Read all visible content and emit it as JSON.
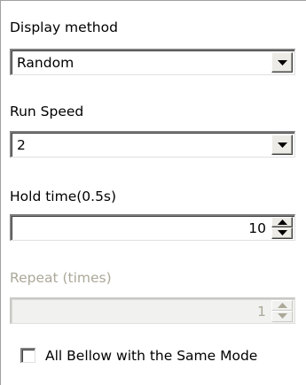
{
  "display_method": {
    "label": "Display method",
    "value": "Random"
  },
  "run_speed": {
    "label": "Run Speed",
    "value": "2"
  },
  "hold_time": {
    "label": "Hold time(0.5s)",
    "value": "10"
  },
  "repeat": {
    "label": "Repeat (times)",
    "value": "1",
    "enabled": false
  },
  "same_mode": {
    "label": "All Bellow with the Same Mode",
    "checked": false
  },
  "icons": {
    "dropdown": "chevron-down-icon",
    "spin_up": "spin-up-icon",
    "spin_down": "spin-down-icon"
  }
}
